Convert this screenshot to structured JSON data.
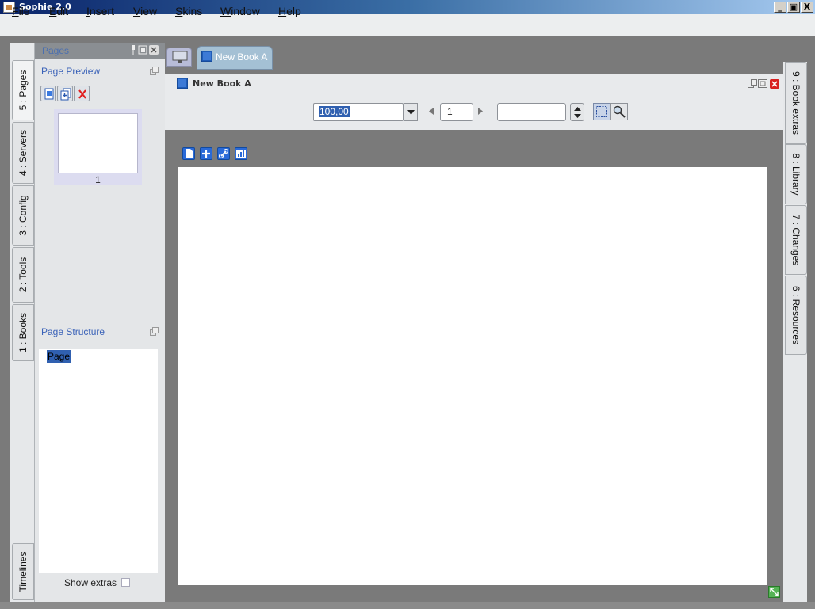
{
  "window": {
    "title": "Sophie 2.0",
    "minimize": "_",
    "restore": "▣",
    "close": "X"
  },
  "menu": [
    "File",
    "Edit",
    "Insert",
    "View",
    "Skins",
    "Window",
    "Help"
  ],
  "left_tabs": [
    "5 : Pages",
    "4 : Servers",
    "3 : Config",
    "2 : Tools",
    "1 : Books",
    "Timelines"
  ],
  "pages_panel": {
    "title": "Pages",
    "preview_label": "Page Preview",
    "thumb_number": "1",
    "structure_label": "Page Structure",
    "structure_item": "Page",
    "show_extras": "Show extras"
  },
  "center": {
    "book_tab": "New Book A",
    "doc_title": "New Book A",
    "zoom_value": "100,00",
    "page_number": "1",
    "spin_value": ""
  },
  "right_tabs": [
    "9 : Book extras",
    "8 : Library",
    "7 : Changes",
    "6 : Resources"
  ],
  "colors": {
    "accent": "#3060b0",
    "canvas_bg": "#7a7a7a",
    "page": "#ffffff"
  }
}
